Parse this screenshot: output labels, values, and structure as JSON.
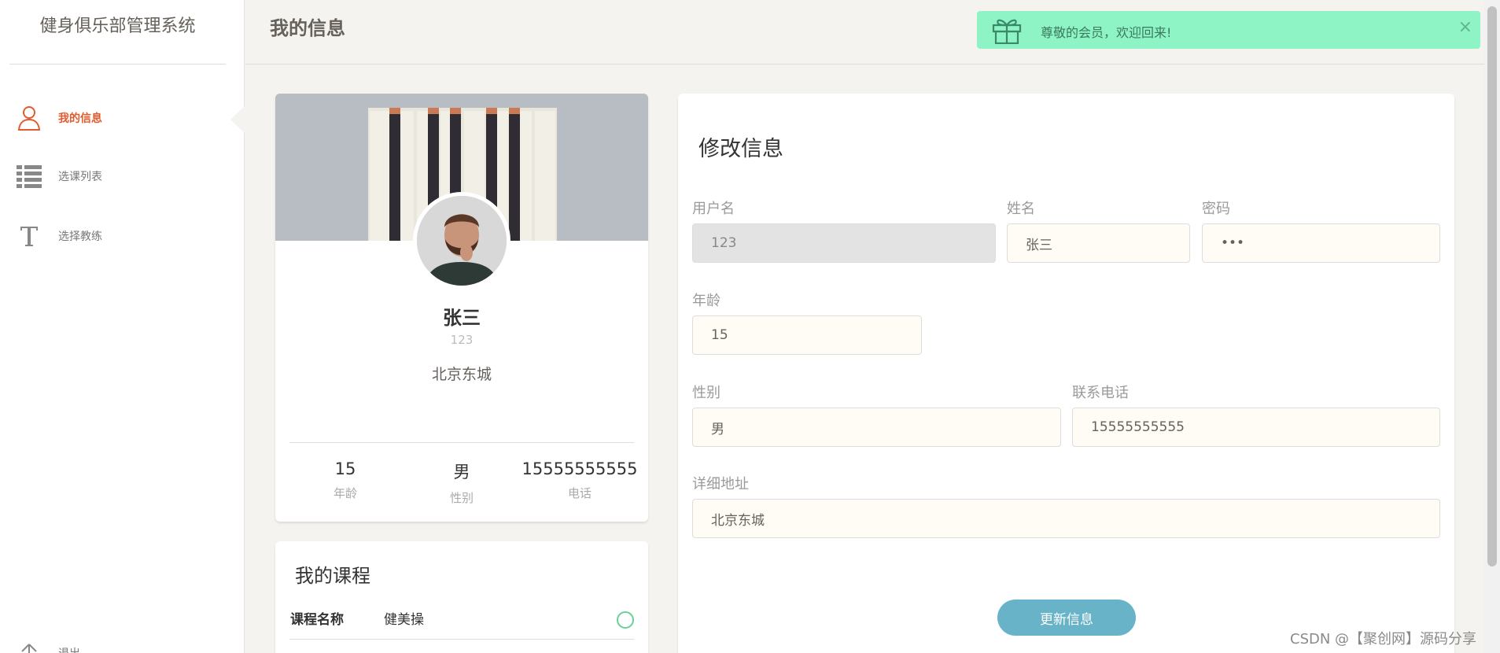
{
  "sidebar": {
    "title": "健身俱乐部管理系统",
    "items": [
      {
        "label": "我的信息",
        "icon": "user-icon",
        "active": true
      },
      {
        "label": "选课列表",
        "icon": "list-icon",
        "active": false
      },
      {
        "label": "选择教练",
        "icon": "text-t-icon",
        "active": false
      },
      {
        "label": "退出",
        "icon": "arrow-up-icon",
        "active": false
      }
    ]
  },
  "header": {
    "title": "我的信息",
    "alert": {
      "icon": "gift-icon",
      "message": "尊敬的会员，欢迎回来!",
      "close": "×",
      "color": "#8ef3c5"
    }
  },
  "profile": {
    "name": "张三",
    "username": "123",
    "address": "北京东城",
    "stats": [
      {
        "value": "15",
        "label": "年龄"
      },
      {
        "value": "男",
        "label": "性别"
      },
      {
        "value": "15555555555",
        "label": "电话"
      }
    ]
  },
  "courses": {
    "title": "我的课程",
    "key_label": "课程名称",
    "items": [
      {
        "name": "健美操"
      }
    ]
  },
  "form": {
    "title": "修改信息",
    "fields": {
      "username": {
        "label": "用户名",
        "value": "123"
      },
      "name": {
        "label": "姓名",
        "value": "张三"
      },
      "password": {
        "label": "密码",
        "value": "•••"
      },
      "age": {
        "label": "年龄",
        "value": "15"
      },
      "gender": {
        "label": "性别",
        "value": "男"
      },
      "phone": {
        "label": "联系电话",
        "value": "15555555555"
      },
      "address": {
        "label": "详细地址",
        "value": "北京东城"
      }
    },
    "submit_label": "更新信息"
  },
  "watermark": "CSDN @【聚创网】源码分享",
  "colors": {
    "accent": "#e05c2e",
    "button": "#68b3c8",
    "success": "#6bd098",
    "background": "#f4f3ef"
  }
}
